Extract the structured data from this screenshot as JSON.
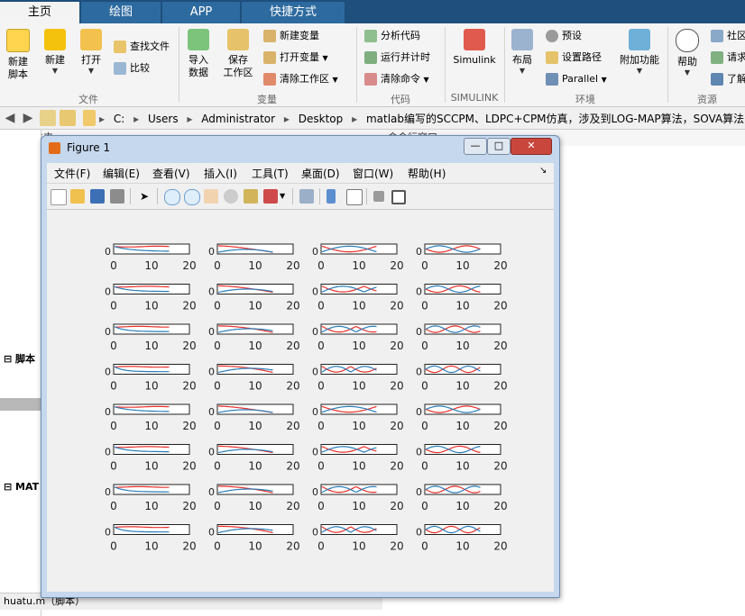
{
  "tabs": [
    "主页",
    "绘图",
    "APP",
    "快捷方式"
  ],
  "ribbon": {
    "file": {
      "new_script": "新建\n脚本",
      "new": "新建",
      "open": "打开",
      "find_files": "查找文件",
      "compare": "比较",
      "group": "文件"
    },
    "variable": {
      "import": "导入\n数据",
      "save_ws": "保存\n工作区",
      "new_var": "新建变量",
      "open_var": "打开变量",
      "clear_ws": "清除工作区",
      "group": "变量"
    },
    "code": {
      "analyze": "分析代码",
      "run_time": "运行并计时",
      "clear_cmd": "清除命令",
      "group": "代码"
    },
    "simulink": {
      "label": "Simulink",
      "group": "SIMULINK"
    },
    "env": {
      "layout": "布局",
      "prefs": "预设",
      "set_path": "设置路径",
      "parallel": "Parallel",
      "addons": "附加功能",
      "group": "环境"
    },
    "resources": {
      "help": "帮助",
      "community": "社区",
      "request": "请求",
      "learn": "了解",
      "group": "资源"
    }
  },
  "address": {
    "crumbs": [
      "C:",
      "Users",
      "Administrator",
      "Desktop",
      "matlab编写的SCCPM、LDPC+CPM仿真，涉及到LOG-MAP算法，SOVA算法，LD"
    ]
  },
  "panels": {
    "current_folder": "当前文件夹",
    "command_window": "命令行窗口",
    "scripts_section": "脚本",
    "mat_section": "MAT",
    "status_file": "huatu.m（脚本）"
  },
  "figure": {
    "title": "Figure 1",
    "menu": [
      "文件(F)",
      "编辑(E)",
      "查看(V)",
      "插入(I)",
      "工具(T)",
      "桌面(D)",
      "窗口(W)",
      "帮助(H)"
    ],
    "buttons": {
      "min": "—",
      "max": "□",
      "close": "✕"
    }
  },
  "chart_data": {
    "type": "line",
    "layout": "8 rows × 4 columns of small subplots",
    "xlim": [
      0,
      20
    ],
    "x_ticks": [
      "0",
      "10",
      "20"
    ],
    "y_tick_label": "0",
    "series_colors": {
      "series1": "#e8302a",
      "series2": "#2a7db8"
    },
    "subplots_count": 32
  },
  "colors": {
    "tabbar": "#1e4f7d",
    "ribbon": "#f4f4f4",
    "figure_frame": "#c5d8ee",
    "plot_red": "#e8302a",
    "plot_blue": "#2a7db8"
  }
}
